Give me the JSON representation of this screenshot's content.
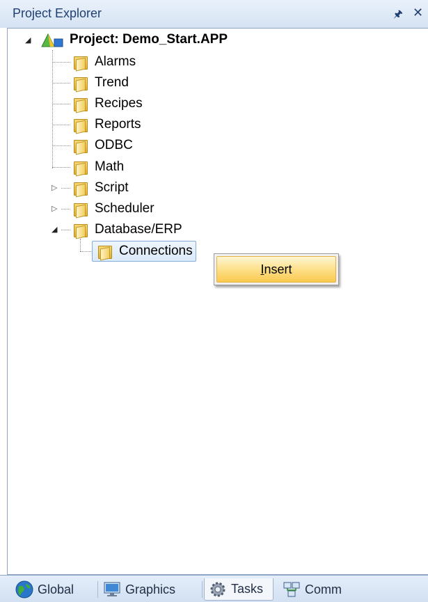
{
  "panel": {
    "title": "Project Explorer"
  },
  "tree": {
    "root": "Project: Demo_Start.APP",
    "items": [
      "Alarms",
      "Trend",
      "Recipes",
      "Reports",
      "ODBC",
      "Math",
      "Script",
      "Scheduler",
      "Database/ERP"
    ],
    "child": "Connections"
  },
  "context_menu": {
    "insert_prefix": "I",
    "insert_rest": "nsert"
  },
  "tabs": [
    "Global",
    "Graphics",
    "Tasks",
    "Comm"
  ],
  "active_tab": "Tasks"
}
